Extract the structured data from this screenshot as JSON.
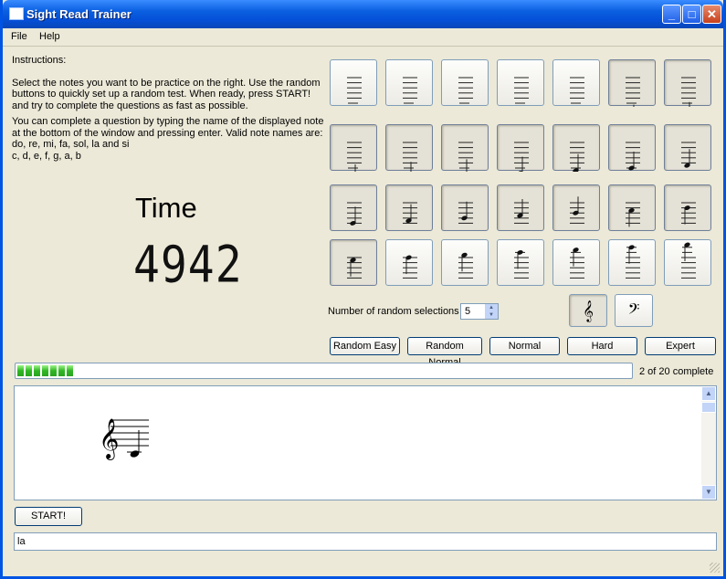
{
  "window": {
    "title": "Sight Read Trainer"
  },
  "menu": [
    "File",
    "Help"
  ],
  "instructions": {
    "heading": "Instructions:",
    "p1": "Select the notes you want to be practice on the right. Use the random buttons to quickly set up a random test. When ready, press START! and try to complete the questions as fast as possible.",
    "p2": "You can complete a question by typing the name of the displayed note at the bottom of the window and pressing enter. Valid note names are: do, re, mi, fa, sol, la and si",
    "p3": "c, d, e, f, g, a, b"
  },
  "timer": {
    "label": "Time",
    "value": "4942"
  },
  "note_grid": {
    "rows": 4,
    "cols": 7,
    "pressed": [
      5,
      6,
      7,
      8,
      9,
      10,
      11,
      12,
      13,
      14,
      15,
      16,
      17,
      18,
      19,
      20,
      21
    ]
  },
  "random": {
    "label": "Number of random selections",
    "value": "5"
  },
  "clefs": [
    {
      "name": "treble-clef",
      "glyph": "𝄞",
      "pressed": true
    },
    {
      "name": "bass-clef",
      "glyph": "𝄢",
      "pressed": false
    }
  ],
  "presets": [
    "Random Easy",
    "Random Normal",
    "Normal",
    "Hard",
    "Expert"
  ],
  "progress": {
    "fraction": 0.1,
    "text": "2 of 20 complete"
  },
  "start_label": "START!",
  "answer": {
    "value": "la"
  },
  "colors": {
    "title_bar": "#0a5fe0",
    "progress": "#2fb624",
    "window_bg": "#ece9d8"
  }
}
